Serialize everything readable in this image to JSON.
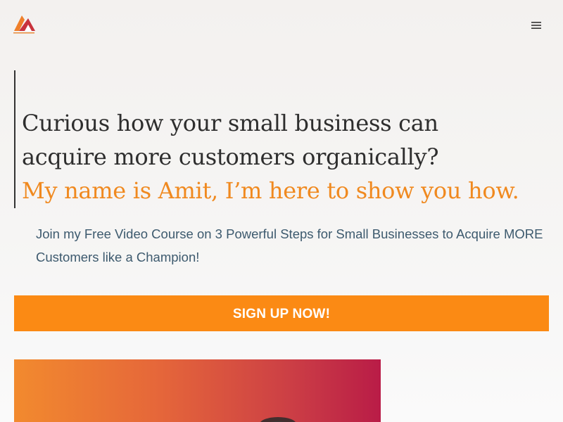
{
  "header": {
    "logo_icon": "triangle-logo-icon",
    "menu_icon": "hamburger-menu-icon"
  },
  "hero": {
    "headline_line1": "Curious how your small business can",
    "headline_line2": "acquire more customers organically?",
    "headline_accent": "My name is Amit, I’m here to show you how.",
    "accent_color": "#f0891f",
    "subtext": "Join my Free Video Course on 3 Powerful Steps for Small Businesses to Acquire MORE Customers like a Champion!"
  },
  "cta": {
    "label": "SIGN UP NOW!",
    "color": "#fb8a14"
  }
}
